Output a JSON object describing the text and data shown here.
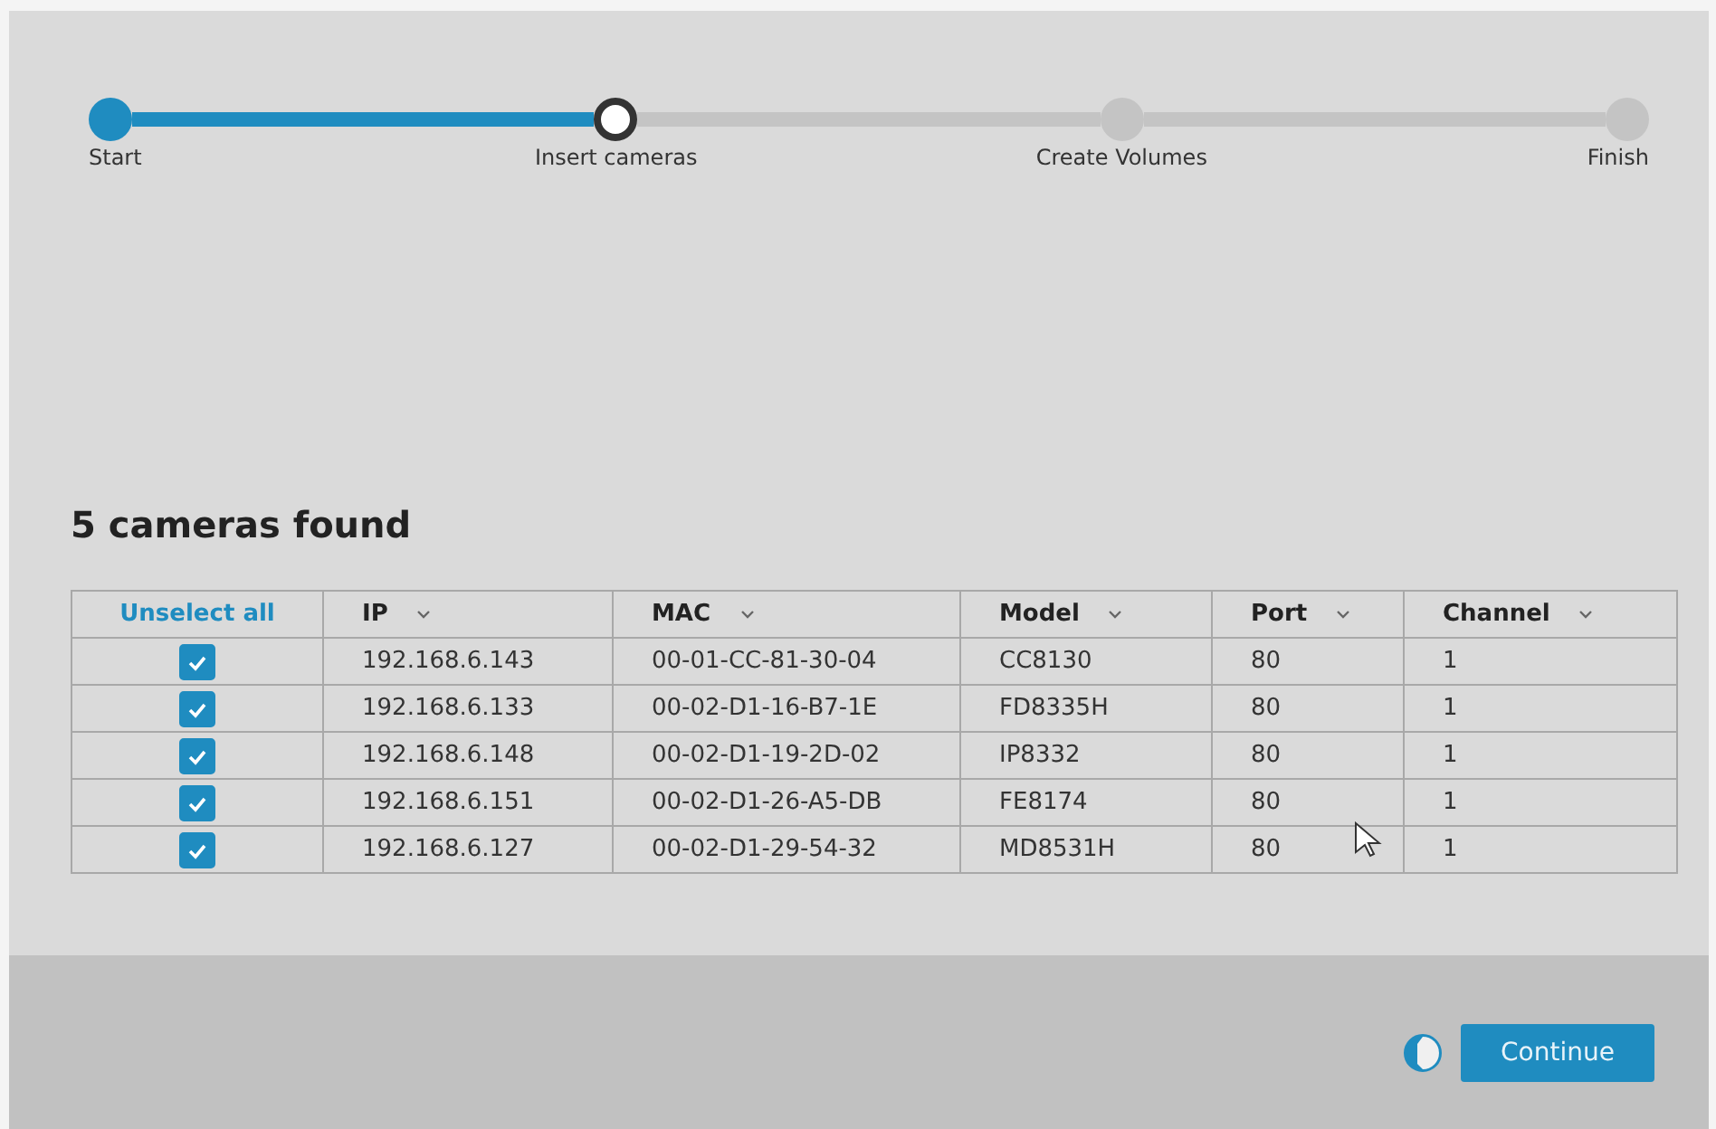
{
  "stepper": {
    "steps": [
      {
        "label": "Start",
        "completed": true,
        "selected": false
      },
      {
        "label": "Insert cameras",
        "completed": false,
        "selected": true
      },
      {
        "label": "Create Volumes",
        "completed": false,
        "selected": false
      },
      {
        "label": "Finish",
        "completed": false,
        "selected": false
      }
    ]
  },
  "heading": "5 cameras found",
  "table": {
    "select_toggle": "Unselect all",
    "columns": [
      "IP",
      "MAC",
      "Model",
      "Port",
      "Channel"
    ],
    "rows": [
      {
        "checked": true,
        "cells": [
          "192.168.6.143",
          "00-01-CC-81-30-04",
          "CC8130",
          "80",
          "1"
        ]
      },
      {
        "checked": true,
        "cells": [
          "192.168.6.133",
          "00-02-D1-16-B7-1E",
          "FD8335H",
          "80",
          "1"
        ]
      },
      {
        "checked": true,
        "cells": [
          "192.168.6.148",
          "00-02-D1-19-2D-02",
          "IP8332",
          "80",
          "1"
        ]
      },
      {
        "checked": true,
        "cells": [
          "192.168.6.151",
          "00-02-D1-26-A5-DB",
          "FE8174",
          "80",
          "1"
        ]
      },
      {
        "checked": true,
        "cells": [
          "192.168.6.127",
          "00-02-D1-29-54-32",
          "MD8531H",
          "80",
          "1"
        ]
      }
    ]
  },
  "footer": {
    "button": "Continue"
  }
}
